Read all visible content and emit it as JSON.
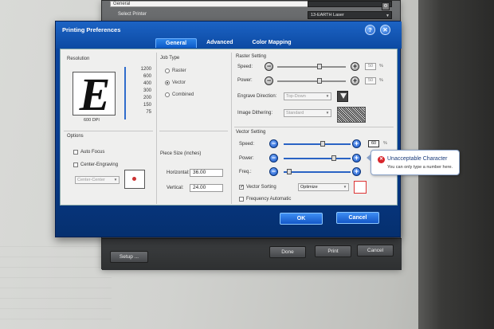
{
  "back_dialog": {
    "top_field_text": "General",
    "select_printer_label": "Select Printer",
    "printer_combo_value": "13-EARTH Laser",
    "setup_button": "Setup ...",
    "done_button": "Done",
    "print_button": "Print",
    "cancel_button": "Cancel"
  },
  "dialog": {
    "title": "Printing Preferences",
    "tabs": [
      {
        "label": "General",
        "active": true
      },
      {
        "label": "Advanced",
        "active": false
      },
      {
        "label": "Color Mapping",
        "active": false
      }
    ],
    "help_icon_glyph": "?",
    "tools_icon_glyph": "✕"
  },
  "resolution": {
    "section_label": "Resolution",
    "preview_letter": "E",
    "current_dpi_label": "600 DPI",
    "dpi_options": [
      "1200",
      "600",
      "400",
      "300",
      "200",
      "150",
      "75"
    ]
  },
  "job_type": {
    "section_label": "Job Type",
    "options": [
      {
        "label": "Raster",
        "selected": false
      },
      {
        "label": "Vector",
        "selected": true
      },
      {
        "label": "Combined",
        "selected": false
      }
    ]
  },
  "raster": {
    "section_label": "Raster Setting",
    "speed_label": "Speed:",
    "power_label": "Power:",
    "speed_value": "50",
    "power_value": "50",
    "percent": "%",
    "engrave_direction_label": "Engrave Direction:",
    "engrave_direction_value": "Top-Down",
    "image_dithering_label": "Image Dithering:",
    "image_dithering_value": "Standard"
  },
  "options": {
    "section_label": "Options",
    "auto_focus_label": "Auto Focus",
    "auto_focus_checked": false,
    "center_engraving_label": "Center-Engraving",
    "center_engraving_checked": false,
    "center_mode_value": "Center-Center"
  },
  "piece_size": {
    "section_label": "Piece Size (inches)",
    "horizontal_label": "Horizontal:",
    "horizontal_value": "36.00",
    "vertical_label": "Vertical:",
    "vertical_value": "24.00"
  },
  "vector": {
    "section_label": "Vector Setting",
    "speed_label": "Speed:",
    "power_label": "Power:",
    "freq_label": "Freq.:",
    "speed_value": "60",
    "percent": "%",
    "vector_sorting_label": "Vector Sorting",
    "vector_sorting_checked": true,
    "sorting_mode_value": "Optimize",
    "frequency_automatic_label": "Frequency Automatic",
    "frequency_automatic_checked": false
  },
  "tooltip": {
    "title": "Unacceptable Character",
    "body": "You can only type a number here.",
    "icon_glyph": "✕"
  },
  "buttons": {
    "ok": "OK",
    "cancel": "Cancel"
  }
}
